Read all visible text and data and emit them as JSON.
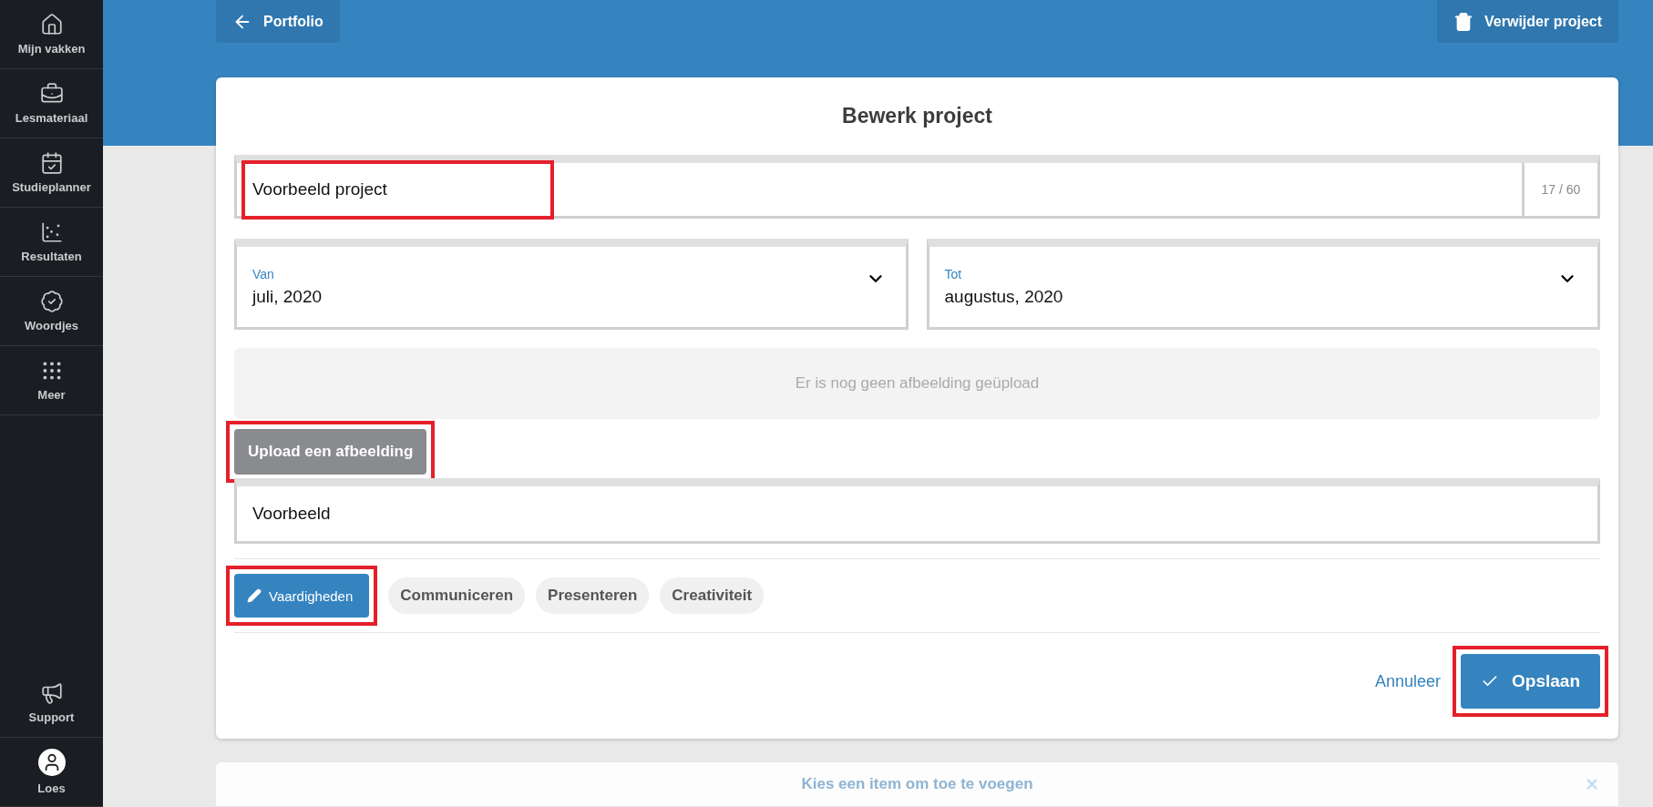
{
  "sidebar": {
    "items": [
      {
        "label": "Mijn vakken"
      },
      {
        "label": "Lesmateriaal"
      },
      {
        "label": "Studieplanner"
      },
      {
        "label": "Resultaten"
      },
      {
        "label": "Woordjes"
      },
      {
        "label": "Meer"
      }
    ],
    "bottom_items": [
      {
        "label": "Support"
      },
      {
        "label": "Loes"
      }
    ]
  },
  "header": {
    "back_button": "Portfolio",
    "delete_button": "Verwijder project"
  },
  "editor": {
    "title": "Bewerk project",
    "name_field": {
      "value": "Voorbeeld project",
      "counter": "17 / 60",
      "highlighted": true
    },
    "from_field": {
      "label": "Van",
      "value": "juli, 2020"
    },
    "to_field": {
      "label": "Tot",
      "value": "augustus, 2020"
    },
    "image_placeholder": "Er is nog geen afbeelding geüpload",
    "upload_button": {
      "label": "Upload een afbeelding",
      "highlighted": true
    },
    "description_field": {
      "value": "Voorbeeld"
    },
    "skills_button": {
      "label": "Vaardigheden",
      "highlighted": true
    },
    "tags": [
      "Communiceren",
      "Presenteren",
      "Creativiteit"
    ],
    "cancel_link": "Annuleer",
    "save_button": {
      "label": "Opslaan",
      "highlighted": true
    }
  },
  "add_panel": {
    "prompt": "Kies een item om toe te voegen",
    "close": "×"
  }
}
